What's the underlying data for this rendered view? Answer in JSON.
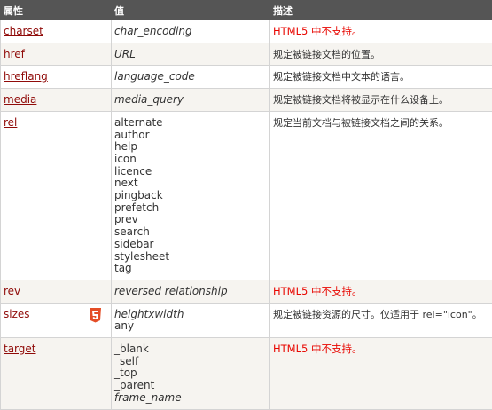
{
  "headers": {
    "attr": "属性",
    "value": "值",
    "desc": "描述"
  },
  "colors": {
    "link": "#900b09",
    "unsupported": "#e80600",
    "header_bg": "#555555",
    "html5_badge": "#e44d26"
  },
  "rows": [
    {
      "attr": "charset",
      "values": [
        "char_encoding"
      ],
      "italic": true,
      "desc": "HTML5 中不支持。",
      "unsupported": true,
      "html5": false
    },
    {
      "attr": "href",
      "values": [
        "URL"
      ],
      "italic": true,
      "desc": "规定被链接文档的位置。",
      "unsupported": false,
      "html5": false
    },
    {
      "attr": "hreflang",
      "values": [
        "language_code"
      ],
      "italic": true,
      "desc": "规定被链接文档中文本的语言。",
      "unsupported": false,
      "html5": false
    },
    {
      "attr": "media",
      "values": [
        "media_query"
      ],
      "italic": true,
      "desc": "规定被链接文档将被显示在什么设备上。",
      "unsupported": false,
      "html5": false
    },
    {
      "attr": "rel",
      "values": [
        "alternate",
        "author",
        "help",
        "icon",
        "licence",
        "next",
        "pingback",
        "prefetch",
        "prev",
        "search",
        "sidebar",
        "stylesheet",
        "tag"
      ],
      "italic": false,
      "desc": "规定当前文档与被链接文档之间的关系。",
      "unsupported": false,
      "html5": false
    },
    {
      "attr": "rev",
      "values": [
        "reversed relationship"
      ],
      "italic": true,
      "desc": "HTML5 中不支持。",
      "unsupported": true,
      "html5": false
    },
    {
      "attr": "sizes",
      "values": [
        "heightxwidth",
        "any"
      ],
      "italic_first": true,
      "desc": "规定被链接资源的尺寸。仅适用于 rel=\"icon\"。",
      "unsupported": false,
      "html5": true
    },
    {
      "attr": "target",
      "values": [
        "_blank",
        "_self",
        "_top",
        "_parent",
        "frame_name"
      ],
      "italic_last": true,
      "desc": "HTML5 中不支持。",
      "unsupported": true,
      "html5": false
    }
  ]
}
